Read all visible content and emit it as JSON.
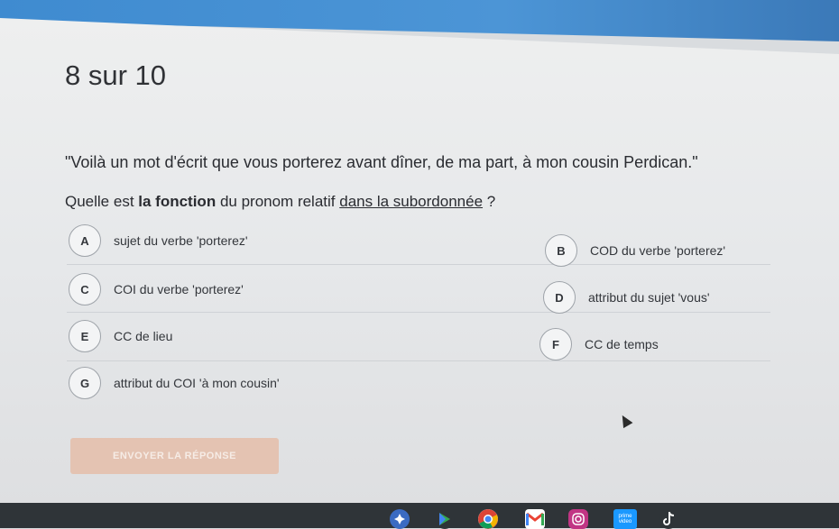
{
  "progress": "8 sur 10",
  "quote": "\"Voilà un mot d'écrit que vous porterez avant dîner, de ma part, à mon cousin Perdican.\"",
  "question": {
    "part1": "Quelle est ",
    "bold": "la fonction",
    "part2": " du pronom relatif ",
    "underline": "dans la subordonnée",
    "part3": " ?"
  },
  "options": [
    {
      "letter": "A",
      "text": "sujet du verbe 'porterez'"
    },
    {
      "letter": "B",
      "text": "COD du verbe 'porterez'"
    },
    {
      "letter": "C",
      "text": "COI du verbe 'porterez'"
    },
    {
      "letter": "D",
      "text": "attribut du sujet 'vous'"
    },
    {
      "letter": "E",
      "text": "CC de lieu"
    },
    {
      "letter": "F",
      "text": "CC de temps"
    },
    {
      "letter": "G",
      "text": "attribut du COI 'à mon cousin'"
    }
  ],
  "submit_label": "ENVOYER LA RÉPONSE",
  "taskbar": {
    "prime_label": "prime video"
  },
  "colors": {
    "top_bar": "#4c95d6",
    "submit_bg": "#e4c3b2",
    "taskbar": "#2f3438"
  }
}
